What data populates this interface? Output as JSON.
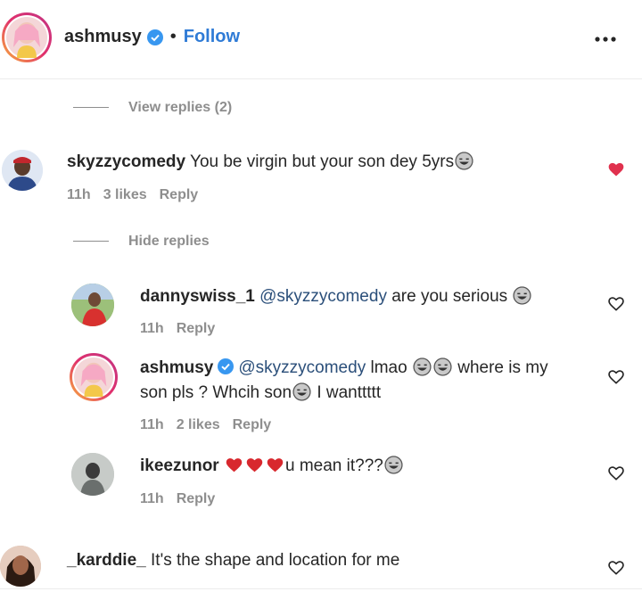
{
  "post_header": {
    "username": "ashmusy",
    "separator": "•",
    "follow_label": "Follow",
    "more_icon": "more-horizontal-icon"
  },
  "thread": {
    "view_replies_label": "View replies (2)",
    "hide_replies_label": "Hide replies"
  },
  "comments": [
    {
      "username": "skyzzycomedy",
      "text": "You be virgin but your son dey 5yrs",
      "time": "11h",
      "likes": "3 likes",
      "reply": "Reply",
      "liked": true,
      "heart_color": "#e0314e"
    },
    {
      "username": "dannyswiss_1",
      "mention": "@skyzzycomedy",
      "text": "are you serious",
      "time": "11h",
      "reply": "Reply"
    },
    {
      "username": "ashmusy",
      "mention": "@skyzzycomedy",
      "text_part1": "lmao",
      "text_part2": "where is my",
      "text_line2a": "son pls ? Whcih son",
      "text_line2b": "I wanttttt",
      "time": "11h",
      "likes": "2 likes",
      "reply": "Reply"
    },
    {
      "username": "ikeezunor",
      "text": "u mean it???",
      "time": "11h",
      "reply": "Reply"
    },
    {
      "username": "_karddie_",
      "text": "It's the shape and location for me"
    }
  ],
  "colors": {
    "follow_blue": "#2f7bd6",
    "verified_blue": "#3897f0",
    "liked_heart": "#e0314e",
    "muted_text": "#8e8e8e"
  }
}
